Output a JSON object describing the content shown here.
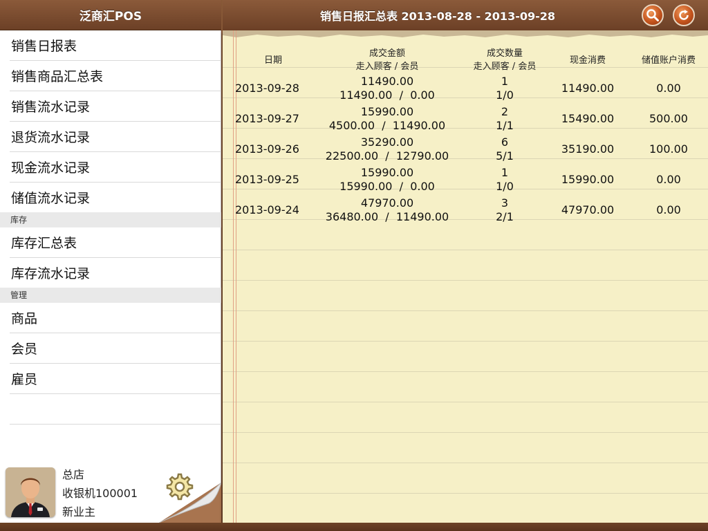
{
  "sidebar": {
    "title": "泛商汇POS",
    "sales_items": [
      "销售日报表",
      "销售商品汇总表",
      "销售流水记录",
      "退货流水记录",
      "现金流水记录",
      "储值流水记录"
    ],
    "inventory_section": "库存",
    "inventory_items": [
      "库存汇总表",
      "库存流水记录"
    ],
    "management_section": "管理",
    "management_items": [
      "商品",
      "会员",
      "雇员"
    ]
  },
  "user": {
    "store": "总店",
    "register": "收银机100001",
    "role": "新业主"
  },
  "header": {
    "title": "销售日报汇总表 2013-08-28 - 2013-09-28",
    "search_icon": "search-icon",
    "refresh_icon": "refresh-icon"
  },
  "report": {
    "columns": {
      "date": "日期",
      "amount": "成交金额",
      "amount_sub": "走入顾客 / 会员",
      "quantity": "成交数量",
      "quantity_sub": "走入顾客 / 会员",
      "cash": "现金消费",
      "stored": "储值账户消费"
    },
    "rows": [
      {
        "date": "2013-09-28",
        "amount": "11490.00",
        "amount_split": "11490.00  /  0.00",
        "qty": "1",
        "qty_split": "1/0",
        "cash": "11490.00",
        "stored": "0.00"
      },
      {
        "date": "2013-09-27",
        "amount": "15990.00",
        "amount_split": "4500.00  /  11490.00",
        "qty": "2",
        "qty_split": "1/1",
        "cash": "15490.00",
        "stored": "500.00"
      },
      {
        "date": "2013-09-26",
        "amount": "35290.00",
        "amount_split": "22500.00  /  12790.00",
        "qty": "6",
        "qty_split": "5/1",
        "cash": "35190.00",
        "stored": "100.00"
      },
      {
        "date": "2013-09-25",
        "amount": "15990.00",
        "amount_split": "15990.00  /  0.00",
        "qty": "1",
        "qty_split": "1/0",
        "cash": "15990.00",
        "stored": "0.00"
      },
      {
        "date": "2013-09-24",
        "amount": "47970.00",
        "amount_split": "36480.00  /  11490.00",
        "qty": "3",
        "qty_split": "2/1",
        "cash": "47970.00",
        "stored": "0.00"
      }
    ]
  },
  "colors": {
    "header_brown": "#7a4c30",
    "accent_orange": "#c5541d",
    "paper": "#f6f0c7"
  }
}
